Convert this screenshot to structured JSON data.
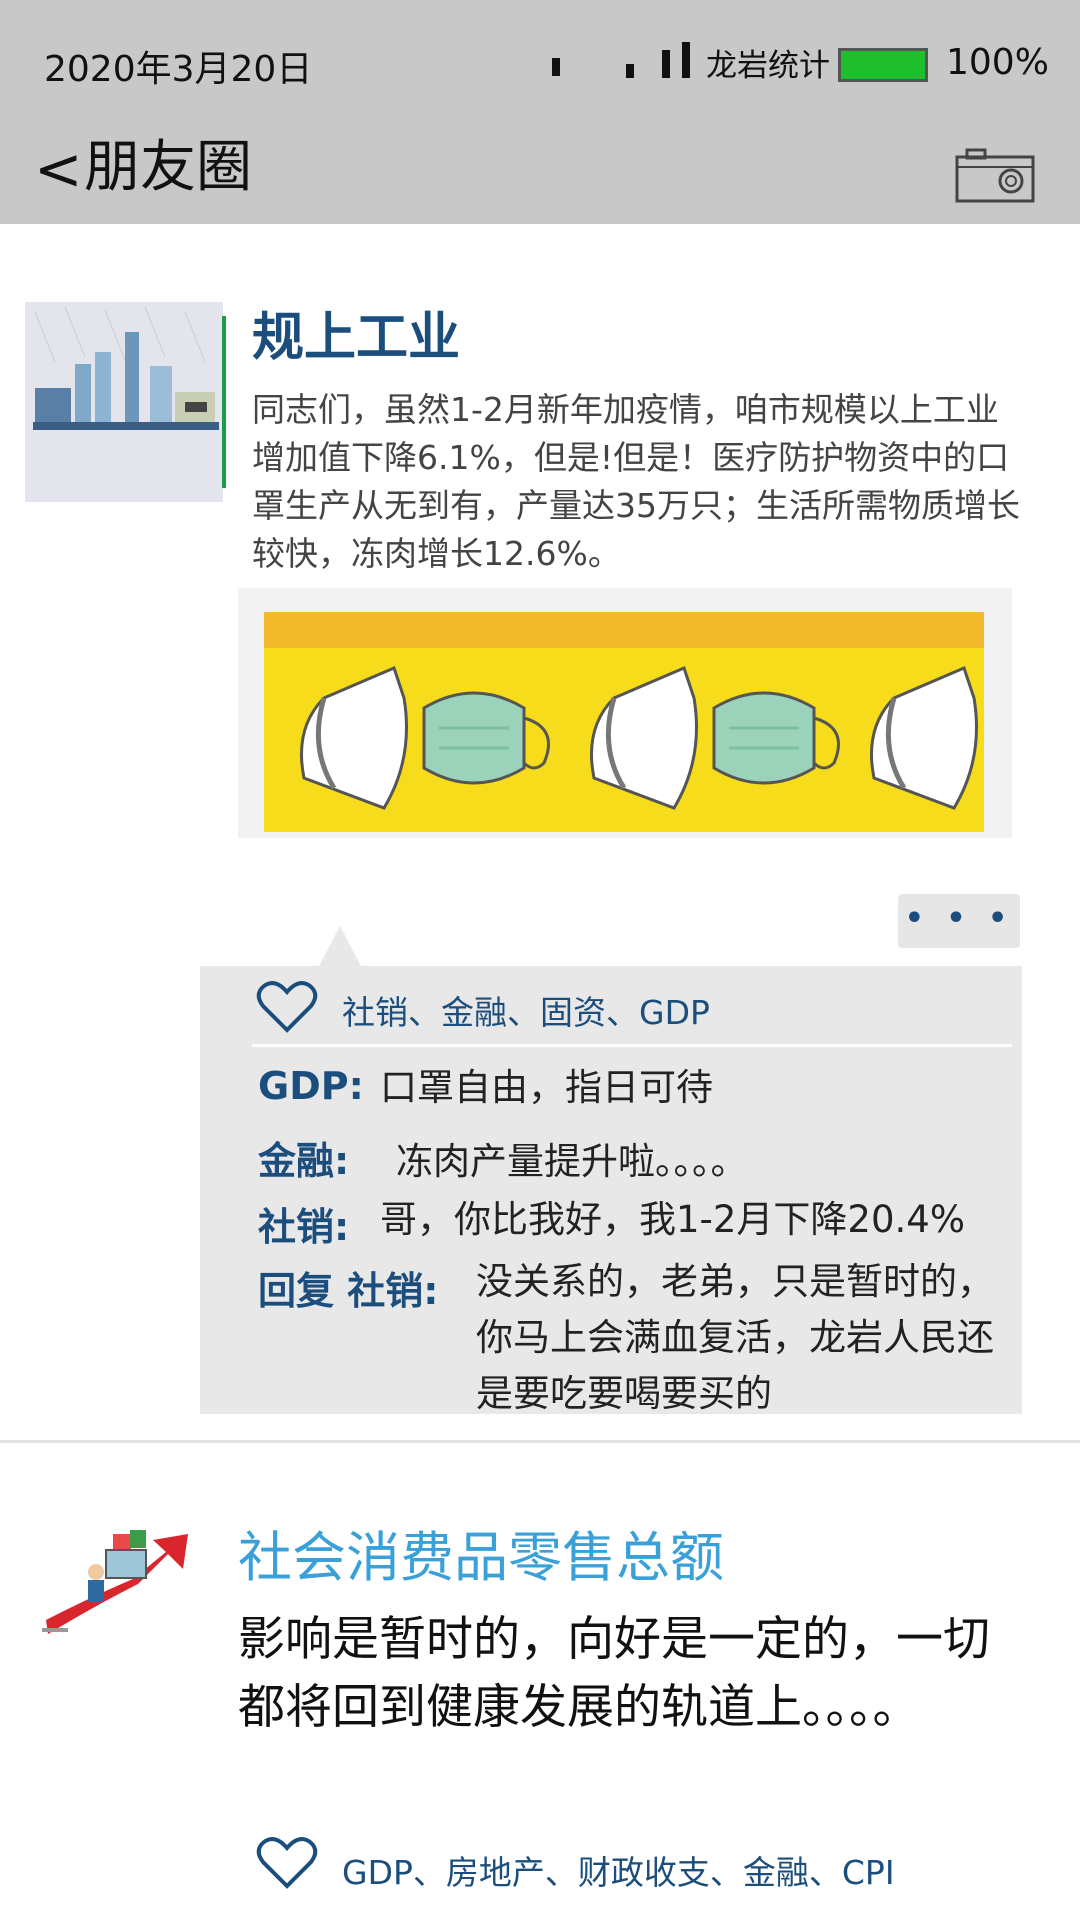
{
  "status_bar": {
    "date": "2020年3月20日",
    "carrier": "龙岩统计",
    "battery": "100%",
    "battery_level": 1.0
  },
  "header": {
    "back_label": "<",
    "title": "朋友圈"
  },
  "post1": {
    "title": "规上工业",
    "body": "同志们，虽然1-2月新年加疫情，咱市规模以上工业增加值下降6.1%，但是!但是！医疗防护物资中的口罩生产从无到有，产量达35万只；生活所需物质增长较快，冻肉增长12.6%。",
    "more_label": "• • •",
    "likes": "社销、金融、固资、GDP",
    "comments": [
      {
        "name": "GDP:",
        "text": "口罩自由，指日可待"
      },
      {
        "name": "金融:",
        "text": "冻肉产量提升啦。。。。"
      },
      {
        "name": "社销:",
        "text": "哥，你比我好，我1-2月下降20.4%"
      },
      {
        "name": "回复 社销:",
        "text": "没关系的，老弟，只是暂时的，你马上会满血复活，龙岩人民还是要吃要喝要买的"
      }
    ]
  },
  "post2": {
    "title": "社会消费品零售总额",
    "body": "影响是暂时的，向好是一定的，一切都将回到健康发展的轨道上。。。。",
    "likes": "GDP、房地产、财政收支、金融、CPI"
  },
  "colors": {
    "header_bg": "#c8c8c8",
    "battery_green": "#1ebe2c",
    "title_blue": "#1b4e7d",
    "title2_blue": "#3aa0d8",
    "mask_yellow": "#f6dc1a"
  },
  "icons": [
    "back-arrow-icon",
    "camera-icon",
    "heart-icon",
    "factory-image",
    "mask-image",
    "shopping-arrow-image"
  ]
}
